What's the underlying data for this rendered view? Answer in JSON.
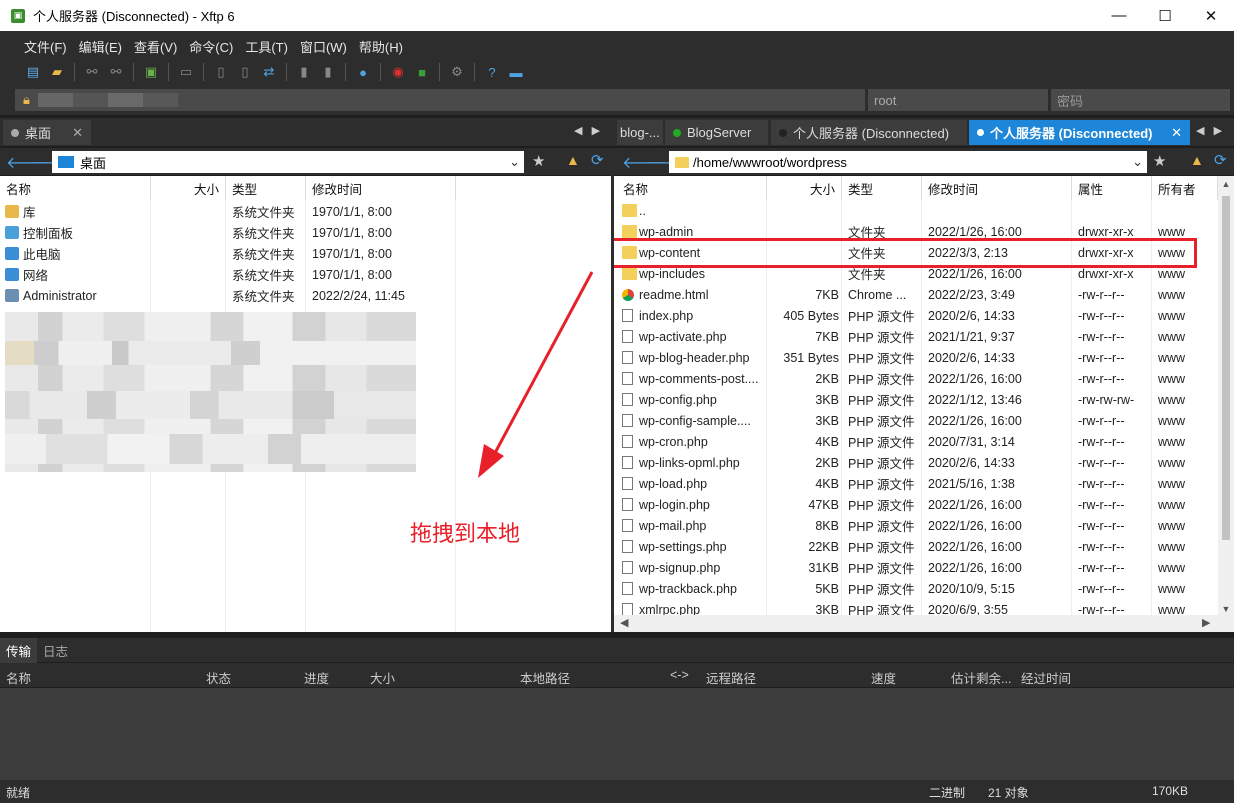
{
  "window": {
    "title": "个人服务器 (Disconnected) - Xftp 6",
    "minimize": "—",
    "maximize": "☐",
    "close": "✕"
  },
  "menu": [
    "文件(F)",
    "编辑(E)",
    "查看(V)",
    "命令(C)",
    "工具(T)",
    "窗口(W)",
    "帮助(H)"
  ],
  "address": {
    "user": "root",
    "password_placeholder": "密码"
  },
  "left_tabs": [
    {
      "label": "桌面"
    }
  ],
  "right_tabs": [
    {
      "label": "blog-..."
    },
    {
      "label": "BlogServer",
      "dot": "#22aa22"
    },
    {
      "label": "个人服务器 (Disconnected)",
      "dot": "#222222"
    },
    {
      "label": "个人服务器 (Disconnected)",
      "dot": "#ffffff"
    }
  ],
  "left_path": "桌面",
  "right_path": "/home/wwwroot/wordpress",
  "left_columns": [
    "名称",
    "大小",
    "类型",
    "修改时间"
  ],
  "right_columns": [
    "名称",
    "大小",
    "类型",
    "修改时间",
    "属性",
    "所有者"
  ],
  "left_files": [
    {
      "name": "库",
      "size": "",
      "type": "系统文件夹",
      "mtime": "1970/1/1, 8:00",
      "icon": "library-icon"
    },
    {
      "name": "控制面板",
      "size": "",
      "type": "系统文件夹",
      "mtime": "1970/1/1, 8:00",
      "icon": "control-panel-icon"
    },
    {
      "name": "此电脑",
      "size": "",
      "type": "系统文件夹",
      "mtime": "1970/1/1, 8:00",
      "icon": "computer-icon"
    },
    {
      "name": "网络",
      "size": "",
      "type": "系统文件夹",
      "mtime": "1970/1/1, 8:00",
      "icon": "network-icon"
    },
    {
      "name": "Administrator",
      "size": "",
      "type": "系统文件夹",
      "mtime": "2022/2/24, 11:45",
      "icon": "user-icon"
    }
  ],
  "right_files": [
    {
      "name": "..",
      "size": "",
      "type": "",
      "mtime": "",
      "perm": "",
      "owner": "",
      "kind": "folder"
    },
    {
      "name": "wp-admin",
      "size": "",
      "type": "文件夹",
      "mtime": "2022/1/26, 16:00",
      "perm": "drwxr-xr-x",
      "owner": "www",
      "kind": "folder"
    },
    {
      "name": "wp-content",
      "size": "",
      "type": "文件夹",
      "mtime": "2022/3/3, 2:13",
      "perm": "drwxr-xr-x",
      "owner": "www",
      "kind": "folder"
    },
    {
      "name": "wp-includes",
      "size": "",
      "type": "文件夹",
      "mtime": "2022/1/26, 16:00",
      "perm": "drwxr-xr-x",
      "owner": "www",
      "kind": "folder"
    },
    {
      "name": "readme.html",
      "size": "7KB",
      "type": "Chrome ...",
      "mtime": "2022/2/23, 3:49",
      "perm": "-rw-r--r--",
      "owner": "www",
      "kind": "chrome"
    },
    {
      "name": "index.php",
      "size": "405 Bytes",
      "type": "PHP 源文件",
      "mtime": "2020/2/6, 14:33",
      "perm": "-rw-r--r--",
      "owner": "www",
      "kind": "file"
    },
    {
      "name": "wp-activate.php",
      "size": "7KB",
      "type": "PHP 源文件",
      "mtime": "2021/1/21, 9:37",
      "perm": "-rw-r--r--",
      "owner": "www",
      "kind": "file"
    },
    {
      "name": "wp-blog-header.php",
      "size": "351 Bytes",
      "type": "PHP 源文件",
      "mtime": "2020/2/6, 14:33",
      "perm": "-rw-r--r--",
      "owner": "www",
      "kind": "file"
    },
    {
      "name": "wp-comments-post....",
      "size": "2KB",
      "type": "PHP 源文件",
      "mtime": "2022/1/26, 16:00",
      "perm": "-rw-r--r--",
      "owner": "www",
      "kind": "file"
    },
    {
      "name": "wp-config.php",
      "size": "3KB",
      "type": "PHP 源文件",
      "mtime": "2022/1/12, 13:46",
      "perm": "-rw-rw-rw-",
      "owner": "www",
      "kind": "file"
    },
    {
      "name": "wp-config-sample....",
      "size": "3KB",
      "type": "PHP 源文件",
      "mtime": "2022/1/26, 16:00",
      "perm": "-rw-r--r--",
      "owner": "www",
      "kind": "file"
    },
    {
      "name": "wp-cron.php",
      "size": "4KB",
      "type": "PHP 源文件",
      "mtime": "2020/7/31, 3:14",
      "perm": "-rw-r--r--",
      "owner": "www",
      "kind": "file"
    },
    {
      "name": "wp-links-opml.php",
      "size": "2KB",
      "type": "PHP 源文件",
      "mtime": "2020/2/6, 14:33",
      "perm": "-rw-r--r--",
      "owner": "www",
      "kind": "file"
    },
    {
      "name": "wp-load.php",
      "size": "4KB",
      "type": "PHP 源文件",
      "mtime": "2021/5/16, 1:38",
      "perm": "-rw-r--r--",
      "owner": "www",
      "kind": "file"
    },
    {
      "name": "wp-login.php",
      "size": "47KB",
      "type": "PHP 源文件",
      "mtime": "2022/1/26, 16:00",
      "perm": "-rw-r--r--",
      "owner": "www",
      "kind": "file"
    },
    {
      "name": "wp-mail.php",
      "size": "8KB",
      "type": "PHP 源文件",
      "mtime": "2022/1/26, 16:00",
      "perm": "-rw-r--r--",
      "owner": "www",
      "kind": "file"
    },
    {
      "name": "wp-settings.php",
      "size": "22KB",
      "type": "PHP 源文件",
      "mtime": "2022/1/26, 16:00",
      "perm": "-rw-r--r--",
      "owner": "www",
      "kind": "file"
    },
    {
      "name": "wp-signup.php",
      "size": "31KB",
      "type": "PHP 源文件",
      "mtime": "2022/1/26, 16:00",
      "perm": "-rw-r--r--",
      "owner": "www",
      "kind": "file"
    },
    {
      "name": "wp-trackback.php",
      "size": "5KB",
      "type": "PHP 源文件",
      "mtime": "2020/10/9, 5:15",
      "perm": "-rw-r--r--",
      "owner": "www",
      "kind": "file"
    },
    {
      "name": "xmlrpc.php",
      "size": "3KB",
      "type": "PHP 源文件",
      "mtime": "2020/6/9, 3:55",
      "perm": "-rw-r--r--",
      "owner": "www",
      "kind": "file"
    }
  ],
  "annotation": {
    "text": "拖拽到本地",
    "color": "#e8202a"
  },
  "bottom_tabs": [
    "传输",
    "日志"
  ],
  "transfer_columns": [
    "名称",
    "状态",
    "进度",
    "大小",
    "本地路径",
    "<->",
    "远程路径",
    "速度",
    "估计剩余...",
    "经过时间"
  ],
  "status": {
    "left": "就绪",
    "mode": "二进制",
    "count": "21 对象",
    "size": "170KB"
  },
  "colors": {
    "accent": "#1e86d8",
    "chrome_bg": "#2d2d2d"
  }
}
